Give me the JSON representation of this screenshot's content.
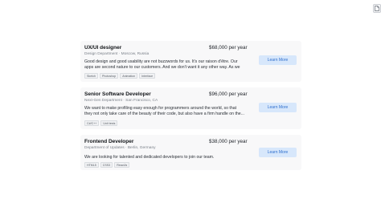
{
  "colors": {
    "card_background": "#f8f8f9",
    "button_background": "#d7e7fb",
    "button_text": "#2e6fce",
    "meta_text": "#7b818a"
  },
  "corner_icon": "document-icon",
  "jobs": [
    {
      "title": "UX/UI designer",
      "meta": "Design Department · Moscow, Russia",
      "salary": "$68,000 per year",
      "description": "Good design and good usability are not buzzwords for us. It's our raison d'être. Our apps are second nature to our customers. And we don't want it any other way. As we scale o...",
      "tags": [
        "Sketch",
        "Photoshop",
        "Animation",
        "Interface"
      ],
      "button": "Learn More"
    },
    {
      "title": "Senior Software Developer",
      "meta": "Next-Gen Department · San Francisco, CA",
      "salary": "$96,000 per year",
      "description": "We want to make profiling easy enough for programmers around the world, so that they not only take care of the beauty of their code, but also have a firm handle on the...",
      "tags": [
        "C#/C++",
        "Unit tests"
      ],
      "button": "Learn More"
    },
    {
      "title": "Frontend Developer",
      "meta": "Department of Updates · Berlin, Germany",
      "salary": "$38,000 per year",
      "description": "We are looking for talented and dedicated developers to join our team.",
      "tags": [
        "HTML5",
        "CSS3",
        "ReactJs"
      ],
      "button": "Learn More"
    }
  ]
}
